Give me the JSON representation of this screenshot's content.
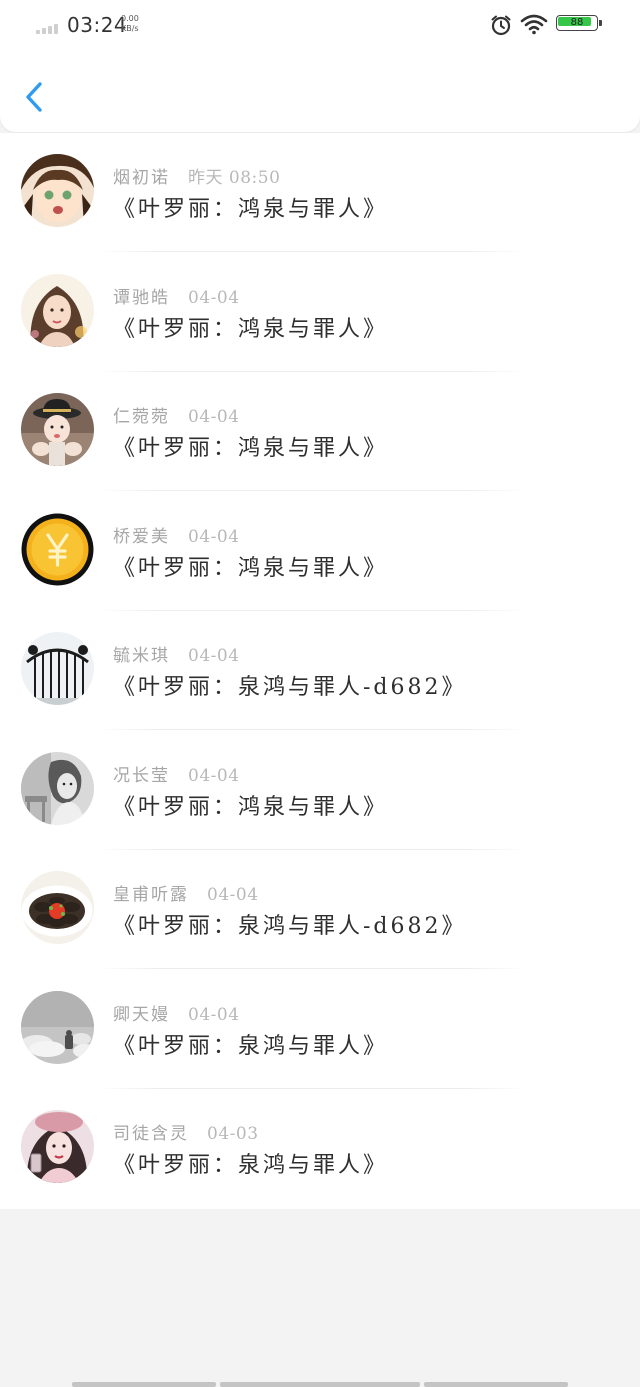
{
  "status_bar": {
    "time": "03:24",
    "net_speed_value": "0.00",
    "net_speed_unit": "KB/s",
    "battery": "88",
    "battery_color": "#36c74a"
  },
  "header": {
    "accent_color": "#2f9bf0",
    "back_icon": "chevron-left-icon"
  },
  "messages": [
    {
      "name": "烟初诺",
      "time": "昨天 08:50",
      "title": "《叶罗丽：鸿泉与罪人》",
      "avatar": "anime-girl"
    },
    {
      "name": "谭驰皓",
      "time": "04-04",
      "title": "《叶罗丽：鸿泉与罪人》",
      "avatar": "woman-portrait"
    },
    {
      "name": "仁菀菀",
      "time": "04-04",
      "title": "《叶罗丽：鸿泉与罪人》",
      "avatar": "girl-with-hat"
    },
    {
      "name": "桥爱美",
      "time": "04-04",
      "title": "《叶罗丽：鸿泉与罪人》",
      "avatar": "yuan-coin"
    },
    {
      "name": "毓米琪",
      "time": "04-04",
      "title": "《叶罗丽：泉鸿与罪人-d682》",
      "avatar": "iron-gate"
    },
    {
      "name": "况长莹",
      "time": "04-04",
      "title": "《叶罗丽：鸿泉与罪人》",
      "avatar": "bw-child"
    },
    {
      "name": "皇甫听露",
      "time": "04-04",
      "title": "《叶罗丽：泉鸿与罪人-d682》",
      "avatar": "food-plate"
    },
    {
      "name": "卿天嫚",
      "time": "04-04",
      "title": "《叶罗丽：泉鸿与罪人》",
      "avatar": "gray-sky"
    },
    {
      "name": "司徒含灵",
      "time": "04-03",
      "title": "《叶罗丽：泉鸿与罪人》",
      "avatar": "girl-with-beret"
    }
  ]
}
